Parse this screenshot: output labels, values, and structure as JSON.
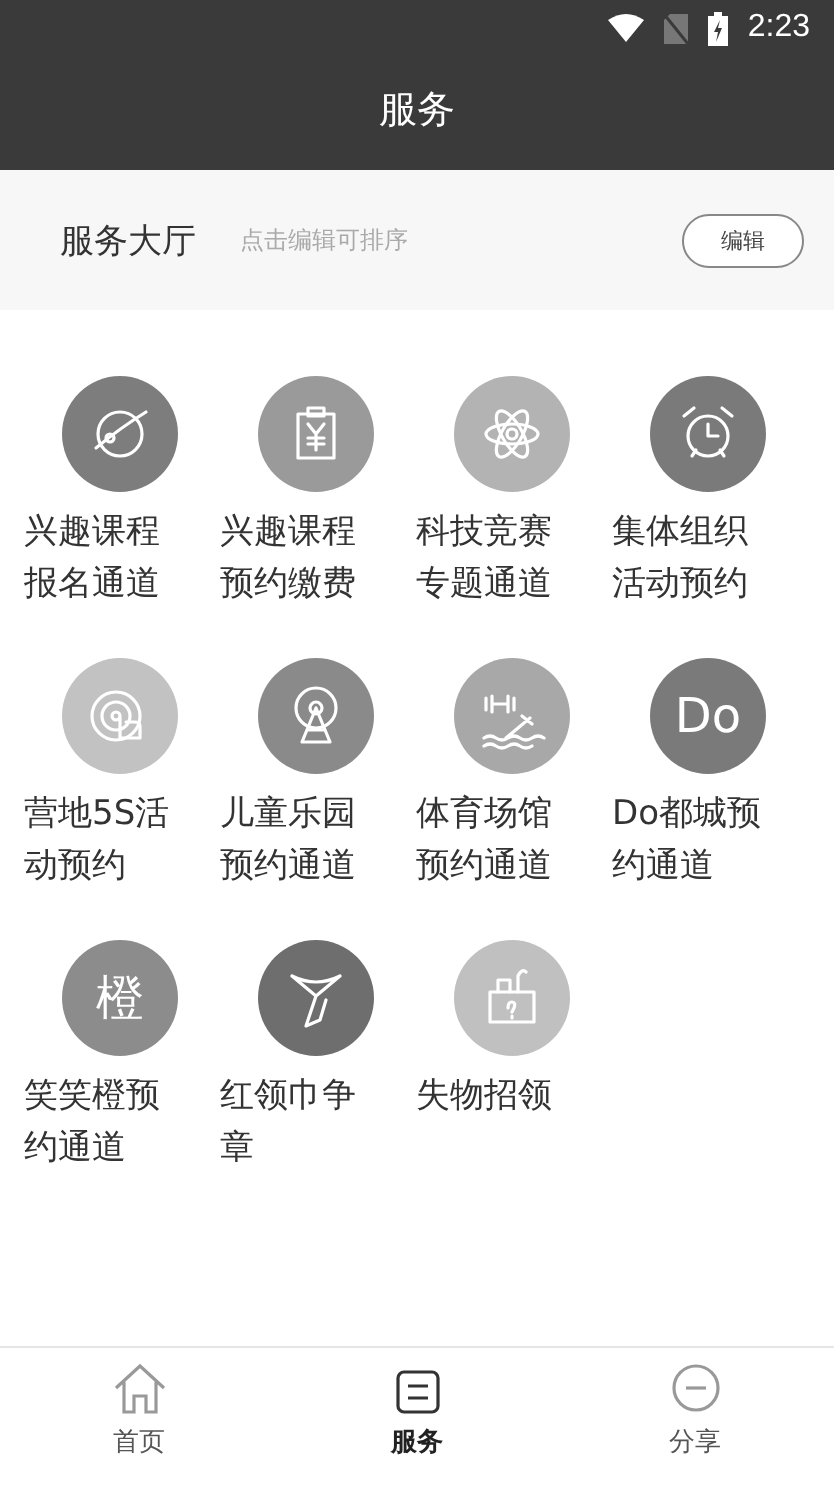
{
  "status_bar": {
    "time": "2:23"
  },
  "title": "服务",
  "hall": {
    "title": "服务大厅",
    "hint": "点击编辑可排序",
    "edit_button": "编辑"
  },
  "services": [
    {
      "lines": [
        "兴趣课程",
        "报名通道"
      ]
    },
    {
      "lines": [
        "兴趣课程",
        "预约缴费"
      ]
    },
    {
      "lines": [
        "科技竞赛",
        "专题通道"
      ]
    },
    {
      "lines": [
        "集体组织",
        "活动预约"
      ]
    },
    {
      "lines": [
        "营地5S活",
        "动预约"
      ]
    },
    {
      "lines": [
        "儿童乐园",
        "预约通道"
      ]
    },
    {
      "lines": [
        "体育场馆",
        "预约通道"
      ]
    },
    {
      "lines": [
        "Do都城预",
        "约通道"
      ],
      "badge": "Do"
    },
    {
      "lines": [
        "笑笑橙预",
        "约通道"
      ],
      "badge": "橙"
    },
    {
      "lines": [
        "红领巾争",
        "章"
      ]
    },
    {
      "lines": [
        "失物招领"
      ]
    }
  ],
  "tabs": [
    {
      "label": "首页",
      "selected": false
    },
    {
      "label": "服务",
      "selected": true
    },
    {
      "label": "分享",
      "selected": false
    }
  ]
}
